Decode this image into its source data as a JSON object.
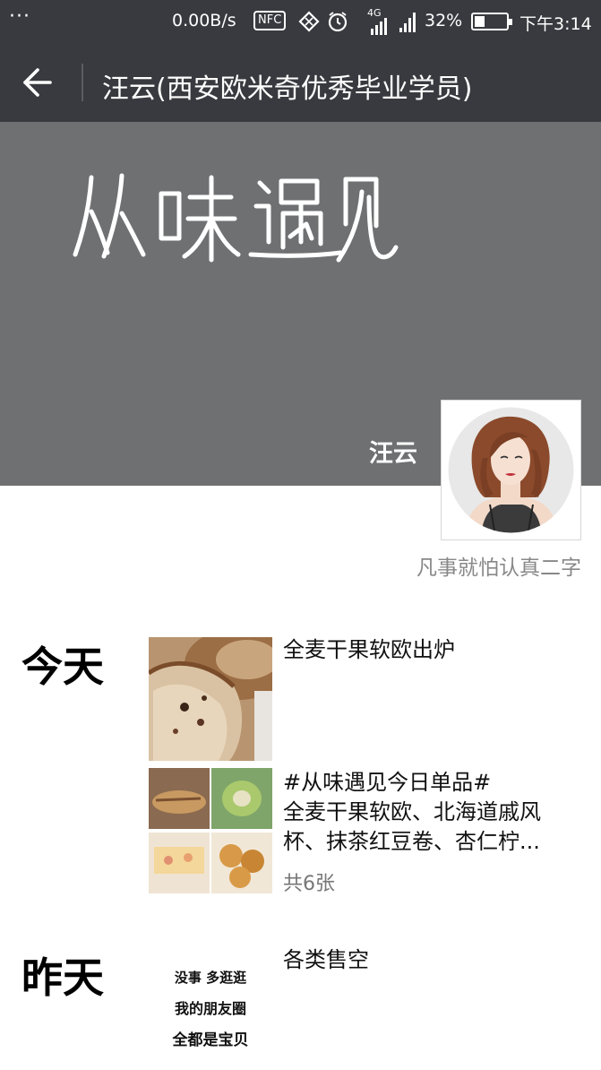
{
  "status_bar": {
    "dots": "···",
    "speed": "0.00B/s",
    "nfc": "NFC",
    "network": "4G",
    "battery": "32%",
    "battery_level": 0.32,
    "time": "下午3:14"
  },
  "header": {
    "title": "汪云(西安欧米奇优秀毕业学员)"
  },
  "cover": {
    "handwritten_text": "从味遇见",
    "name": "汪云"
  },
  "profile": {
    "signature": "凡事就怕认真二字"
  },
  "timeline": [
    {
      "day": "今天",
      "posts": [
        {
          "text": "全麦干果软欧出炉"
        },
        {
          "text": "#从味遇见今日单品#\n全麦干果软欧、北海道戚风杯、抹茶红豆卷、杏仁柠...",
          "count": "共6张"
        }
      ]
    },
    {
      "day": "昨天",
      "posts": [
        {
          "image_lines": [
            "没事 多逛逛",
            "我的朋友圈",
            "全都是宝贝"
          ],
          "text": "各类售空"
        }
      ]
    }
  ],
  "colors": {
    "bar": "#393a3f",
    "cover": "#6e7072",
    "secondary_text": "#888888"
  }
}
